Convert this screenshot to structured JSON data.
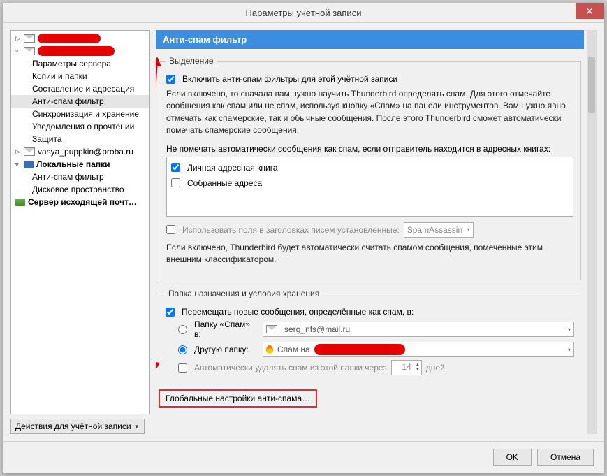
{
  "window": {
    "title": "Параметры учётной записи"
  },
  "tree": {
    "account1_sub": [
      "Параметры сервера",
      "Копии и папки",
      "Составление и адресация",
      "Анти-спам фильтр",
      "Синхронизация и хранение",
      "Уведомления о прочтении",
      "Защита"
    ],
    "account2_label": "vasya_puppkin@proba.ru",
    "local_label": "Локальные папки",
    "local_sub": [
      "Анти-спам фильтр",
      "Дисковое пространство"
    ],
    "outgoing_label": "Сервер исходящей почт…"
  },
  "actions_label": "Действия для учётной записи",
  "panel": {
    "title": "Анти-спам фильтр",
    "section1": "Выделение",
    "enable_label": "Включить анти-спам фильтры для этой учётной записи",
    "desc": "Если включено, то сначала вам нужно научить Thunderbird определять спам. Для этого отмечайте сообщения как спам или не спам, используя кнопку «Спам» на панели инструментов. Вам нужно явно отмечать как спамерские, так и обычные сообщения. После этого Thunderbird сможет автоматически помечать спамерские сообщения.",
    "whitelist_label": "Не помечать автоматически сообщения как спам, если отправитель находится в адресных книгах:",
    "book1": "Личная адресная книга",
    "book2": "Собранные адреса",
    "trust_label": "Использовать поля в заголовках писем установленные:",
    "trust_combo": "SpamAssassin",
    "trust_desc": "Если включено, Thunderbird будет автоматически считать спамом сообщения, помеченные этим внешним классификатором.",
    "section2": "Папка назначения и условия хранения",
    "move_label": "Перемещать новые сообщения, определённые как спам, в:",
    "radio1": "Папку «Спам» в:",
    "radio1_val": "serg_nfs@mail.ru",
    "radio2": "Другую папку:",
    "radio2_val": "Спам на",
    "autodelete": "Автоматически удалять спам из этой папки через",
    "days_value": "14",
    "days_suffix": "дней",
    "global_btn": "Глобальные настройки анти-спама…"
  },
  "footer": {
    "ok": "OK",
    "cancel": "Отмена"
  }
}
